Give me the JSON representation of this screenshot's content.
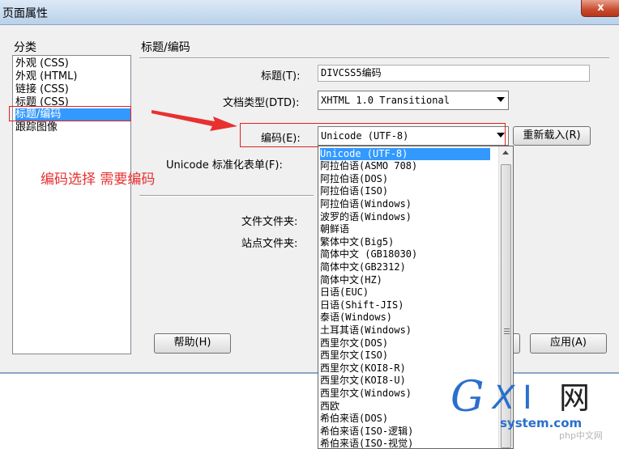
{
  "window": {
    "title": "页面属性",
    "close_label": "x"
  },
  "category": {
    "heading": "分类",
    "items": [
      "外观 (CSS)",
      "外观 (HTML)",
      "链接 (CSS)",
      "标题 (CSS)",
      "标题/编码",
      "跟踪图像"
    ],
    "selected_index": 4
  },
  "panel": {
    "heading": "标题/编码",
    "title_label": "标题(T):",
    "title_value": "DIVCSS5编码",
    "doctype_label": "文档类型(DTD):",
    "doctype_value": "XHTML 1.0 Transitional",
    "encoding_label": "编码(E):",
    "encoding_value": "Unicode (UTF-8)",
    "reload_label": "重新载入(R)",
    "normalize_label": "Unicode 标准化表单(F):",
    "doc_folder_label": "文件文件夹:",
    "site_folder_label": "站点文件夹:"
  },
  "buttons": {
    "help": "帮助(H)",
    "apply": "应用(A)"
  },
  "annotation": {
    "text": "编码选择 需要编码",
    "color": "#e83030"
  },
  "dropdown": {
    "options": [
      "Unicode (UTF-8)",
      "阿拉伯语(ASMO 708)",
      "阿拉伯语(DOS)",
      "阿拉伯语(ISO)",
      "阿拉伯语(Windows)",
      "波罗的语(Windows)",
      "朝鲜语",
      "繁体中文(Big5)",
      "简体中文 (GB18030)",
      "简体中文(GB2312)",
      "简体中文(HZ)",
      "日语(EUC)",
      "日语(Shift-JIS)",
      "泰语(Windows)",
      "土耳其语(Windows)",
      "西里尔文(DOS)",
      "西里尔文(ISO)",
      "西里尔文(KOI8-R)",
      "西里尔文(KOI8-U)",
      "西里尔文(Windows)",
      "西欧",
      "希伯来语(DOS)",
      "希伯来语(ISO-逻辑)",
      "希伯来语(ISO-视觉)"
    ],
    "selected_index": 0
  },
  "watermark": {
    "g": "G",
    "x": "X",
    "i": "I",
    "net": "网",
    "system": "system.com",
    "php": "php中文网"
  },
  "colors": {
    "selection": "#3399ff",
    "annotation": "#e83030",
    "watermark": "#2a6fcc"
  }
}
